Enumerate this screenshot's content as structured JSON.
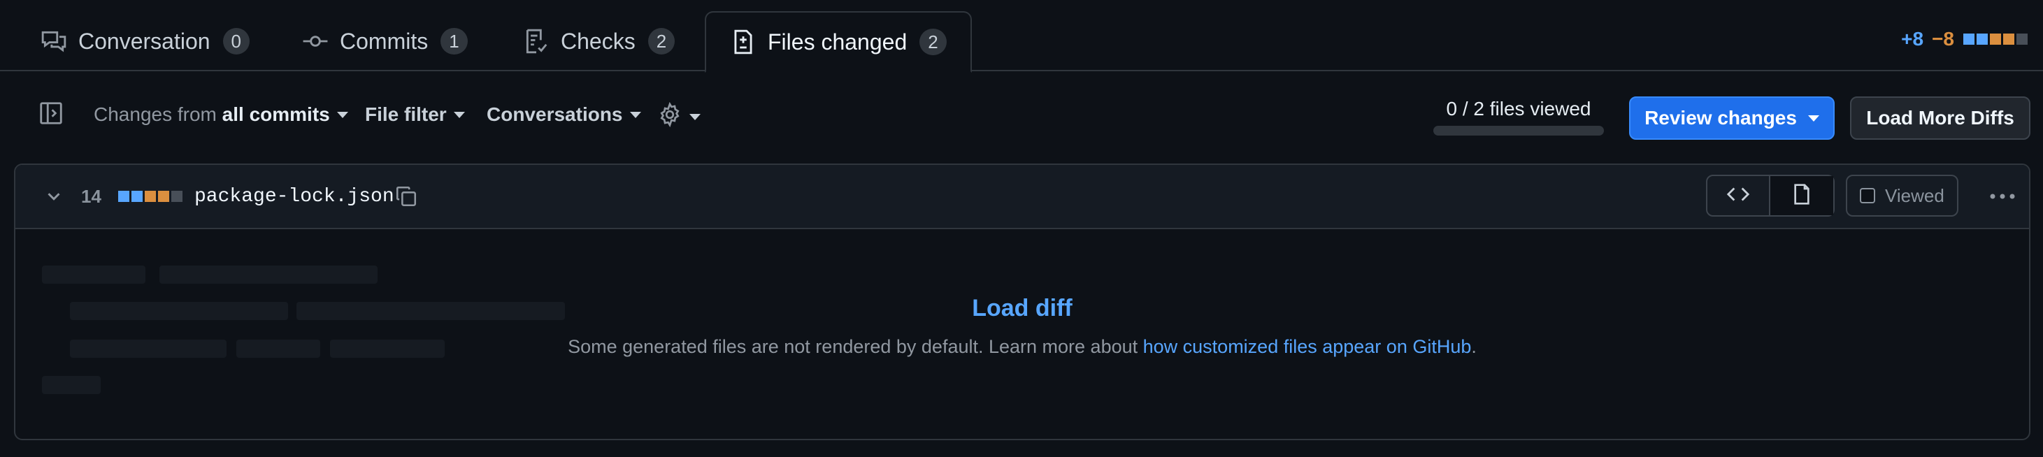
{
  "tabs": [
    {
      "label": "Conversation",
      "count": "0",
      "icon": "comment-discussion-icon"
    },
    {
      "label": "Commits",
      "count": "1",
      "icon": "git-commit-icon"
    },
    {
      "label": "Checks",
      "count": "2",
      "icon": "checklist-icon"
    },
    {
      "label": "Files changed",
      "count": "2",
      "icon": "file-diff-icon",
      "active": true
    }
  ],
  "diffstat": {
    "additions": "+8",
    "deletions": "−8",
    "colors": {
      "added": "#58a6ff",
      "deleted": "#db8f3f",
      "neutral": "#484f58"
    }
  },
  "toolbar": {
    "changes_from_prefix": "Changes from",
    "changes_from_value": "all commits",
    "file_filter": "File filter",
    "conversations": "Conversations",
    "files_viewed": "0 / 2 files viewed",
    "files_viewed_fraction": 0,
    "review_changes": "Review changes",
    "load_more_diffs": "Load More Diffs"
  },
  "file": {
    "changes": "14",
    "name": "package-lock.json",
    "viewed_label": "Viewed",
    "viewed_checked": false,
    "load_diff": {
      "title": "Load diff",
      "message": "Some generated files are not rendered by default. Learn more about",
      "link_text": "how customized files appear on GitHub",
      "trailing": "."
    }
  },
  "colors": {
    "accent": "#1f6feb",
    "link": "#58a6ff",
    "background": "#0d1117",
    "border": "#30363d"
  }
}
